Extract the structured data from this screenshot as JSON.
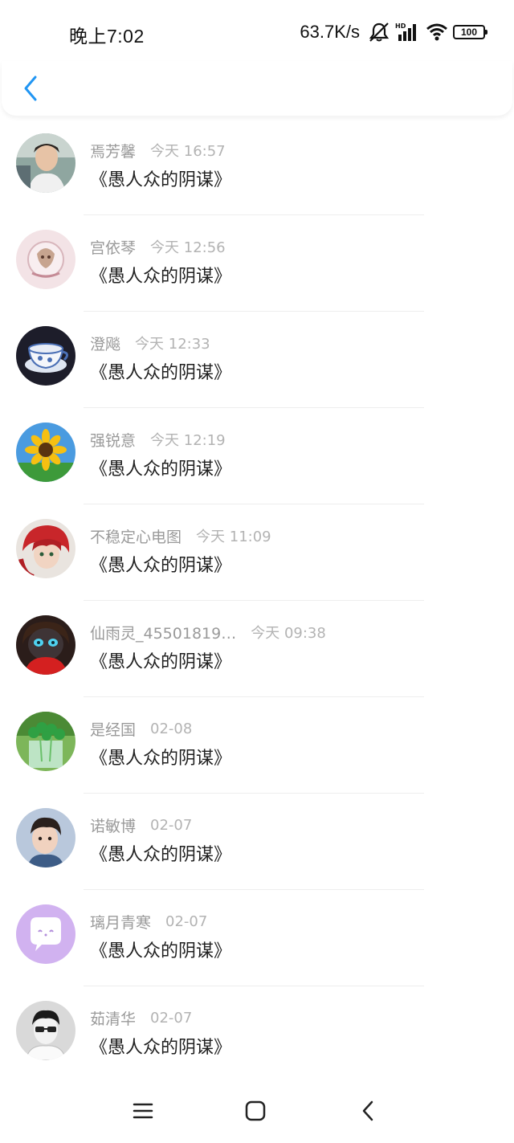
{
  "status_bar": {
    "time": "晚上7:02",
    "net_speed": "63.7K/s",
    "battery_level": "100",
    "icons": [
      "mute-bell-icon",
      "hd-signal-icon",
      "wifi-icon",
      "battery-icon"
    ]
  },
  "header": {
    "back_icon": "chevron-left-icon",
    "accent_color": "#2196f3"
  },
  "comments": [
    {
      "name": "焉芳馨",
      "time": "今天 16:57",
      "title": "《愚人众的阴谋》",
      "avatar": "photo-young-man"
    },
    {
      "name": "宫依琴",
      "time": "今天 12:56",
      "title": "《愚人众的阴谋》",
      "avatar": "illustration-pink"
    },
    {
      "name": "澄飚",
      "time": "今天 12:33",
      "title": "《愚人众的阴谋》",
      "avatar": "tea-cup"
    },
    {
      "name": "强锐意",
      "time": "今天 12:19",
      "title": "《愚人众的阴谋》",
      "avatar": "sunflower"
    },
    {
      "name": "不稳定心电图",
      "time": "今天 11:09",
      "title": "《愚人众的阴谋》",
      "avatar": "anime-red-hair"
    },
    {
      "name": "仙雨灵_45501819…",
      "time": "今天 09:38",
      "title": "《愚人众的阴谋》",
      "avatar": "doll-red"
    },
    {
      "name": "是经国",
      "time": "02-08",
      "title": "《愚人众的阴谋》",
      "avatar": "green-plant-glass"
    },
    {
      "name": "诺敏博",
      "time": "02-07",
      "title": "《愚人众的阴谋》",
      "avatar": "photo-young-man-2"
    },
    {
      "name": "璃月青寒",
      "time": "02-07",
      "title": "《愚人众的阴谋》",
      "avatar": "default-purple-chat"
    },
    {
      "name": "茹清华",
      "time": "02-07",
      "title": "《愚人众的阴谋》",
      "avatar": "bw-portrait"
    }
  ],
  "nav_bar": {
    "menu_icon": "menu-icon",
    "home_icon": "home-square-icon",
    "back_icon": "back-triangle-icon"
  }
}
